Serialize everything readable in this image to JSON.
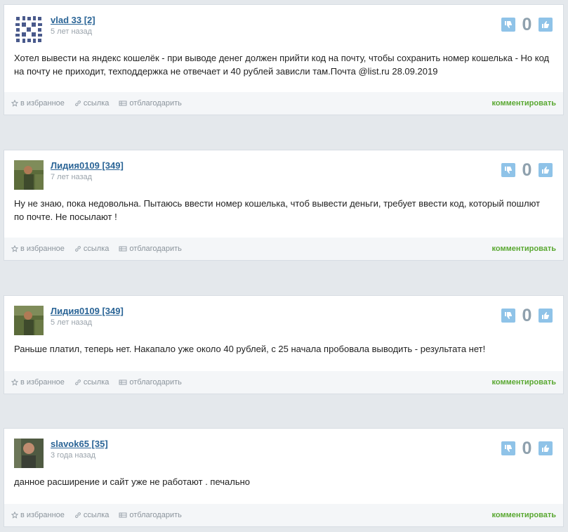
{
  "comments": [
    {
      "author": "vlad 33 [2]",
      "date": "5 лет назад",
      "avatar": "pattern-avatar",
      "text": "Хотел вывести на яндекс кошелёк - при выводе денег должен прийти код на почту, чтобы сохранить номер кошелька - Но код на почту не приходит, техподдержка не отвечает и 40 рублей зависли там.Почта @list.ru 28.09.2019",
      "votes": "0"
    },
    {
      "author": "Лидия0109 [349]",
      "date": "7 лет назад",
      "avatar": "photo-avatar",
      "text": "Ну не знаю, пока недовольна. Пытаюсь ввести номер кошелька, чтоб вывести деньги, требует ввести код, который пошлют по почте. Не посылают !",
      "votes": "0"
    },
    {
      "author": "Лидия0109 [349]",
      "date": "5 лет назад",
      "avatar": "photo-avatar",
      "text": "Раньше платил, теперь нет. Накапало уже около 40 рублей, с 25 начала пробовала выводить - результата нет!",
      "votes": "0"
    },
    {
      "author": "slavok65 [35]",
      "date": "3 года назад",
      "avatar": "photo-avatar",
      "text": "данное расширение и сайт уже не работают . печально",
      "votes": "0"
    }
  ],
  "footer": {
    "favorite": "в избранное",
    "link": "ссылка",
    "thank": "отблагодарить",
    "comment": "комментировать"
  },
  "icons": {
    "favorite": "star-icon",
    "link": "link-icon",
    "thank": "gift-icon",
    "dislike": "thumbs-down-icon",
    "like": "thumbs-up-icon"
  },
  "colors": {
    "accent": "#5aa832",
    "author_link": "#2a6496",
    "vote_button": "#8fc3e8",
    "vote_count": "#8fa1ae"
  }
}
